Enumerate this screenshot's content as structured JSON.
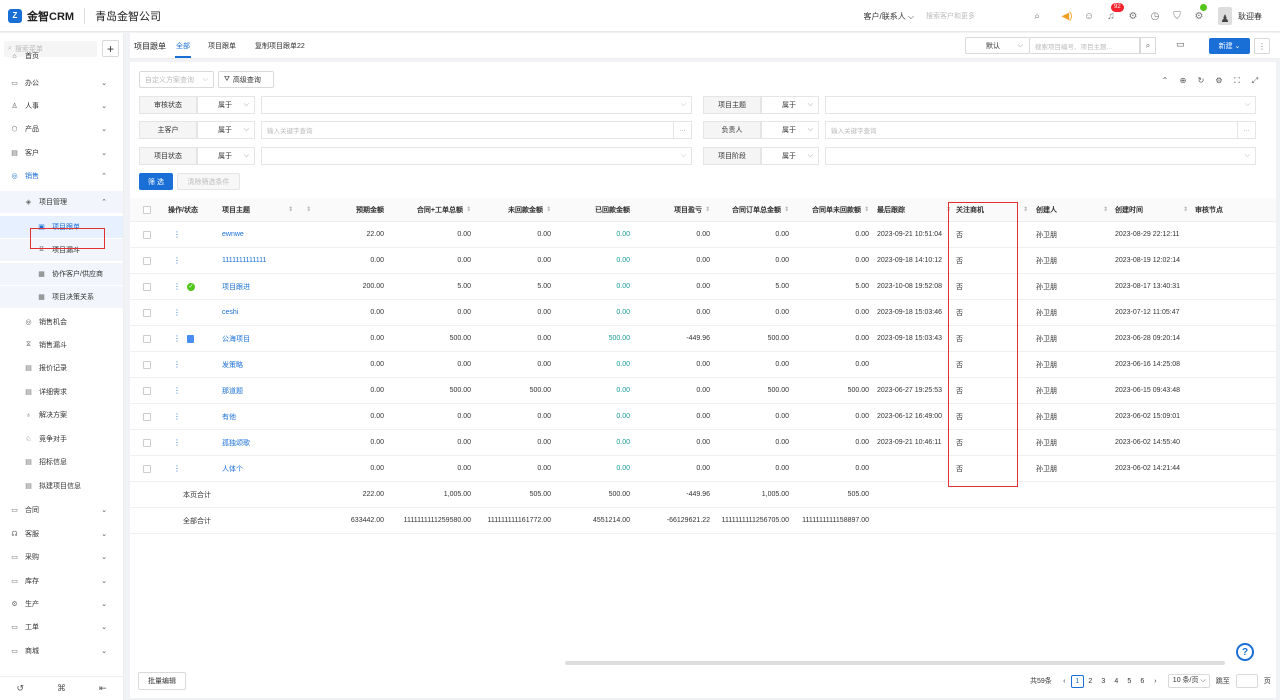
{
  "app": {
    "logo_mark": "Z",
    "name": "金智CRM",
    "company": "青岛金智公司"
  },
  "topbar": {
    "scope": "客户/联系人 ⌵",
    "search_placeholder": "搜索客户和更多",
    "notif_count": "92",
    "user_name": "耿迎春",
    "icons": [
      "search-icon",
      "sound-icon",
      "contacts-icon",
      "bell-icon",
      "gear-icon",
      "clock-icon",
      "shield-icon",
      "puzzle-icon"
    ]
  },
  "sidebar": {
    "search_placeholder": "搜索菜单",
    "items": [
      {
        "label": "首页",
        "icon": "⌂",
        "chev": ""
      },
      {
        "label": "办公",
        "icon": "▭",
        "chev": "⌄"
      },
      {
        "label": "人事",
        "icon": "♙",
        "chev": "⌄"
      },
      {
        "label": "产品",
        "icon": "⬡",
        "chev": "⌄"
      },
      {
        "label": "客户",
        "icon": "▤",
        "chev": "⌄"
      },
      {
        "label": "销售",
        "icon": "◎",
        "chev": "⌃"
      },
      {
        "label": "项目管理",
        "icon": "◈",
        "chev": "⌃"
      },
      {
        "label": "项目跟单",
        "icon": "▣",
        "chev": ""
      },
      {
        "label": "项目漏斗",
        "icon": "⧖",
        "chev": ""
      },
      {
        "label": "协作客户/供应商",
        "icon": "▦",
        "chev": ""
      },
      {
        "label": "项目决策关系",
        "icon": "▦",
        "chev": ""
      },
      {
        "label": "销售机会",
        "icon": "◎",
        "chev": ""
      },
      {
        "label": "销售漏斗",
        "icon": "⧖",
        "chev": ""
      },
      {
        "label": "报价记录",
        "icon": "▤",
        "chev": ""
      },
      {
        "label": "详细需求",
        "icon": "▤",
        "chev": ""
      },
      {
        "label": "解决方案",
        "icon": "♁",
        "chev": ""
      },
      {
        "label": "竞争对手",
        "icon": "♘",
        "chev": ""
      },
      {
        "label": "招标信息",
        "icon": "▤",
        "chev": ""
      },
      {
        "label": "拟建项目信息",
        "icon": "▤",
        "chev": ""
      },
      {
        "label": "合同",
        "icon": "▭",
        "chev": "⌄"
      },
      {
        "label": "客服",
        "icon": "☊",
        "chev": "⌄"
      },
      {
        "label": "采购",
        "icon": "▭",
        "chev": "⌄"
      },
      {
        "label": "库存",
        "icon": "▭",
        "chev": "⌄"
      },
      {
        "label": "生产",
        "icon": "⚙",
        "chev": "⌄"
      },
      {
        "label": "工单",
        "icon": "▭",
        "chev": "⌄"
      },
      {
        "label": "商城",
        "icon": "▭",
        "chev": "⌄"
      }
    ],
    "bottom_icons": [
      "history-icon",
      "link-icon",
      "collapse-icon"
    ]
  },
  "tabs": {
    "page_title": "项目跟单",
    "items": [
      "全部",
      "项目跟单",
      "复制项目跟单22"
    ]
  },
  "header_actions": {
    "view": "默认",
    "search_placeholder": "搜索项目编号、项目主题...",
    "new_label": "新建 ⌄"
  },
  "filters": {
    "custom_placeholder": "自定义方案查询",
    "advanced": "高级查询",
    "rows": [
      {
        "label": "审核状态",
        "op": "属于",
        "placeholder": ""
      },
      {
        "label": "主客户",
        "op": "属于",
        "placeholder": "输入关键字查询"
      },
      {
        "label": "项目状态",
        "op": "属于",
        "placeholder": ""
      },
      {
        "label": "项目主题",
        "op": "属于",
        "placeholder": ""
      },
      {
        "label": "负责人",
        "op": "属于",
        "placeholder": "输入关键字查询"
      },
      {
        "label": "项目阶段",
        "op": "属于",
        "placeholder": ""
      }
    ],
    "filter_btn": "筛 选",
    "clear_btn": "清除筛选条件"
  },
  "table": {
    "headers": [
      "操作/状态",
      "项目主题",
      "预期金额",
      "合同+工单总额",
      "未回款金额",
      "已回款金额",
      "项目盈亏",
      "合同订单总金额",
      "合同单未回款额",
      "最后跟踪",
      "关注商机",
      "创建人",
      "创建时间",
      "审核节点"
    ],
    "rows": [
      {
        "status": "",
        "title": "ewnwe",
        "c1": "22.00",
        "c2": "0.00",
        "c3": "0.00",
        "c4": "0.00",
        "c5": "0.00",
        "c6": "0.00",
        "c7": "0.00",
        "last": "2023-09-21 10:51:04",
        "focus": "否",
        "creator": "孙卫朋",
        "created": "2023-08-29 22:12:11"
      },
      {
        "status": "",
        "title": "1111111111111",
        "c1": "0.00",
        "c2": "0.00",
        "c3": "0.00",
        "c4": "0.00",
        "c5": "0.00",
        "c6": "0.00",
        "c7": "0.00",
        "last": "2023-09-18 14:10:12",
        "focus": "否",
        "creator": "孙卫朋",
        "created": "2023-08-19 12:02:14"
      },
      {
        "status": "ok",
        "title": "项目跟进",
        "c1": "200.00",
        "c2": "5.00",
        "c3": "5.00",
        "c4": "0.00",
        "c5": "0.00",
        "c6": "5.00",
        "c7": "5.00",
        "last": "2023-10-08 19:52:08",
        "focus": "否",
        "creator": "孙卫朋",
        "created": "2023-08-17 13:40:31"
      },
      {
        "status": "",
        "title": "ceshi",
        "c1": "0.00",
        "c2": "0.00",
        "c3": "0.00",
        "c4": "0.00",
        "c5": "0.00",
        "c6": "0.00",
        "c7": "0.00",
        "last": "2023-09-18 15:03:46",
        "focus": "否",
        "creator": "孙卫朋",
        "created": "2023-07-12 11:05:47"
      },
      {
        "status": "doc",
        "title": "公海项目",
        "c1": "0.00",
        "c2": "500.00",
        "c3": "0.00",
        "c4": "500.00",
        "c5": "-449.96",
        "c6": "500.00",
        "c7": "0.00",
        "last": "2023-09-18 15:03:43",
        "focus": "否",
        "creator": "孙卫朋",
        "created": "2023-06-28 09:20:14"
      },
      {
        "status": "",
        "title": "发策略",
        "c1": "0.00",
        "c2": "0.00",
        "c3": "0.00",
        "c4": "0.00",
        "c5": "0.00",
        "c6": "0.00",
        "c7": "0.00",
        "last": "",
        "focus": "否",
        "creator": "孙卫朋",
        "created": "2023-06-16 14:25:08"
      },
      {
        "status": "",
        "title": "那道题",
        "c1": "0.00",
        "c2": "500.00",
        "c3": "500.00",
        "c4": "0.00",
        "c5": "0.00",
        "c6": "500.00",
        "c7": "500.00",
        "last": "2023-06-27 19:25:53",
        "focus": "否",
        "creator": "孙卫朋",
        "created": "2023-06-15 09:43:48"
      },
      {
        "status": "",
        "title": "有他",
        "c1": "0.00",
        "c2": "0.00",
        "c3": "0.00",
        "c4": "0.00",
        "c5": "0.00",
        "c6": "0.00",
        "c7": "0.00",
        "last": "2023-06-12 16:49:00",
        "focus": "否",
        "creator": "孙卫朋",
        "created": "2023-06-02 15:09:01"
      },
      {
        "status": "",
        "title": "孤独颂歌",
        "c1": "0.00",
        "c2": "0.00",
        "c3": "0.00",
        "c4": "0.00",
        "c5": "0.00",
        "c6": "0.00",
        "c7": "0.00",
        "last": "2023-09-21 10:46:11",
        "focus": "否",
        "creator": "孙卫朋",
        "created": "2023-06-02 14:55:40"
      },
      {
        "status": "",
        "title": "人体个",
        "c1": "0.00",
        "c2": "0.00",
        "c3": "0.00",
        "c4": "0.00",
        "c5": "0.00",
        "c6": "0.00",
        "c7": "0.00",
        "last": "",
        "focus": "否",
        "creator": "孙卫朋",
        "created": "2023-06-02 14:21:44"
      }
    ],
    "page_total": {
      "label": "本页合计",
      "c1": "222.00",
      "c2": "1,005.00",
      "c3": "505.00",
      "c4": "500.00",
      "c5": "-449.96",
      "c6": "1,005.00",
      "c7": "505.00"
    },
    "all_total": {
      "label": "全部合计",
      "c1": "633442.00",
      "c2": "1111111111259580.00",
      "c3": "111111111161772.00",
      "c4": "4551214.00",
      "c5": "-66129621.22",
      "c6": "1111111111256705.00",
      "c7": "1111111111158897.00"
    }
  },
  "footer": {
    "batch_label": "批量编辑",
    "total": "共59条",
    "pages": [
      "1",
      "2",
      "3",
      "4",
      "5",
      "6"
    ],
    "current_page": "1",
    "page_size": "10 条/页 ⌵",
    "goto_label": "跳至",
    "page_suffix": "页",
    "prev": "‹",
    "next": "›"
  },
  "accent": "#1a6fd6",
  "highlight": "#e2302e"
}
